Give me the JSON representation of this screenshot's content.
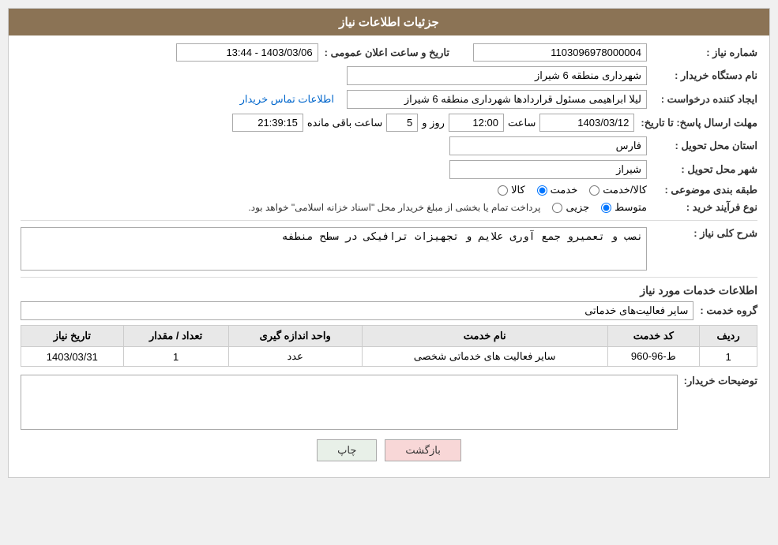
{
  "header": {
    "title": "جزئیات اطلاعات نیاز"
  },
  "fields": {
    "niyaz_number_label": "شماره نیاز :",
    "niyaz_number_value": "1103096978000004",
    "dastgah_label": "نام دستگاه خریدار :",
    "dastgah_value": "شهرداری منطقه 6 شیراز",
    "creator_label": "ایجاد کننده درخواست :",
    "creator_value": "لیلا ابراهیمی مسئول قراردادها شهرداری منطقه 6 شیراز",
    "creator_link": "اطلاعات تماس خریدار",
    "date_label": "تاریخ و ساعت اعلان عمومی :",
    "date_value": "1403/03/06 - 13:44",
    "deadline_label": "مهلت ارسال پاسخ: تا تاریخ:",
    "deadline_date": "1403/03/12",
    "deadline_time_label": "ساعت",
    "deadline_time": "12:00",
    "deadline_day_label": "روز و",
    "deadline_day": "5",
    "deadline_remain_label": "ساعت باقی مانده",
    "deadline_remain": "21:39:15",
    "province_label": "استان محل تحویل :",
    "province_value": "فارس",
    "city_label": "شهر محل تحویل :",
    "city_value": "شیراز",
    "category_label": "طبقه بندی موضوعی :",
    "category_options": [
      {
        "label": "کالا",
        "value": "kala"
      },
      {
        "label": "خدمت",
        "value": "khedmat"
      },
      {
        "label": "کالا/خدمت",
        "value": "kala_khedmat"
      }
    ],
    "category_selected": "khedmat",
    "process_label": "نوع فرآیند خرید :",
    "process_options": [
      {
        "label": "جزیی",
        "value": "jozi"
      },
      {
        "label": "متوسط",
        "value": "motevaset"
      }
    ],
    "process_selected": "motevaset",
    "process_note": "پرداخت تمام یا بخشی از مبلغ خریدار محل \"اسناد خزانه اسلامی\" خواهد بود.",
    "description_label": "شرح کلی نیاز :",
    "description_value": "نصب و تعمیرو جمع آوری علایم و تجهیزات ترافیکی در سطح منطفه",
    "services_title": "اطلاعات خدمات مورد نیاز",
    "group_label": "گروه خدمت :",
    "group_value": "سایر فعالیت‌های خدماتی",
    "table_headers": {
      "radif": "ردیف",
      "code": "کد خدمت",
      "name": "نام خدمت",
      "unit": "واحد اندازه گیری",
      "quantity": "تعداد / مقدار",
      "date": "تاریخ نیاز"
    },
    "table_rows": [
      {
        "radif": "1",
        "code": "ط-96-960",
        "name": "سایر فعالیت های خدماتی شخصی",
        "unit": "عدد",
        "quantity": "1",
        "date": "1403/03/31"
      }
    ],
    "buyer_notes_label": "توضیحات خریدار:",
    "buyer_notes_value": ""
  },
  "buttons": {
    "back": "بازگشت",
    "print": "چاپ"
  }
}
